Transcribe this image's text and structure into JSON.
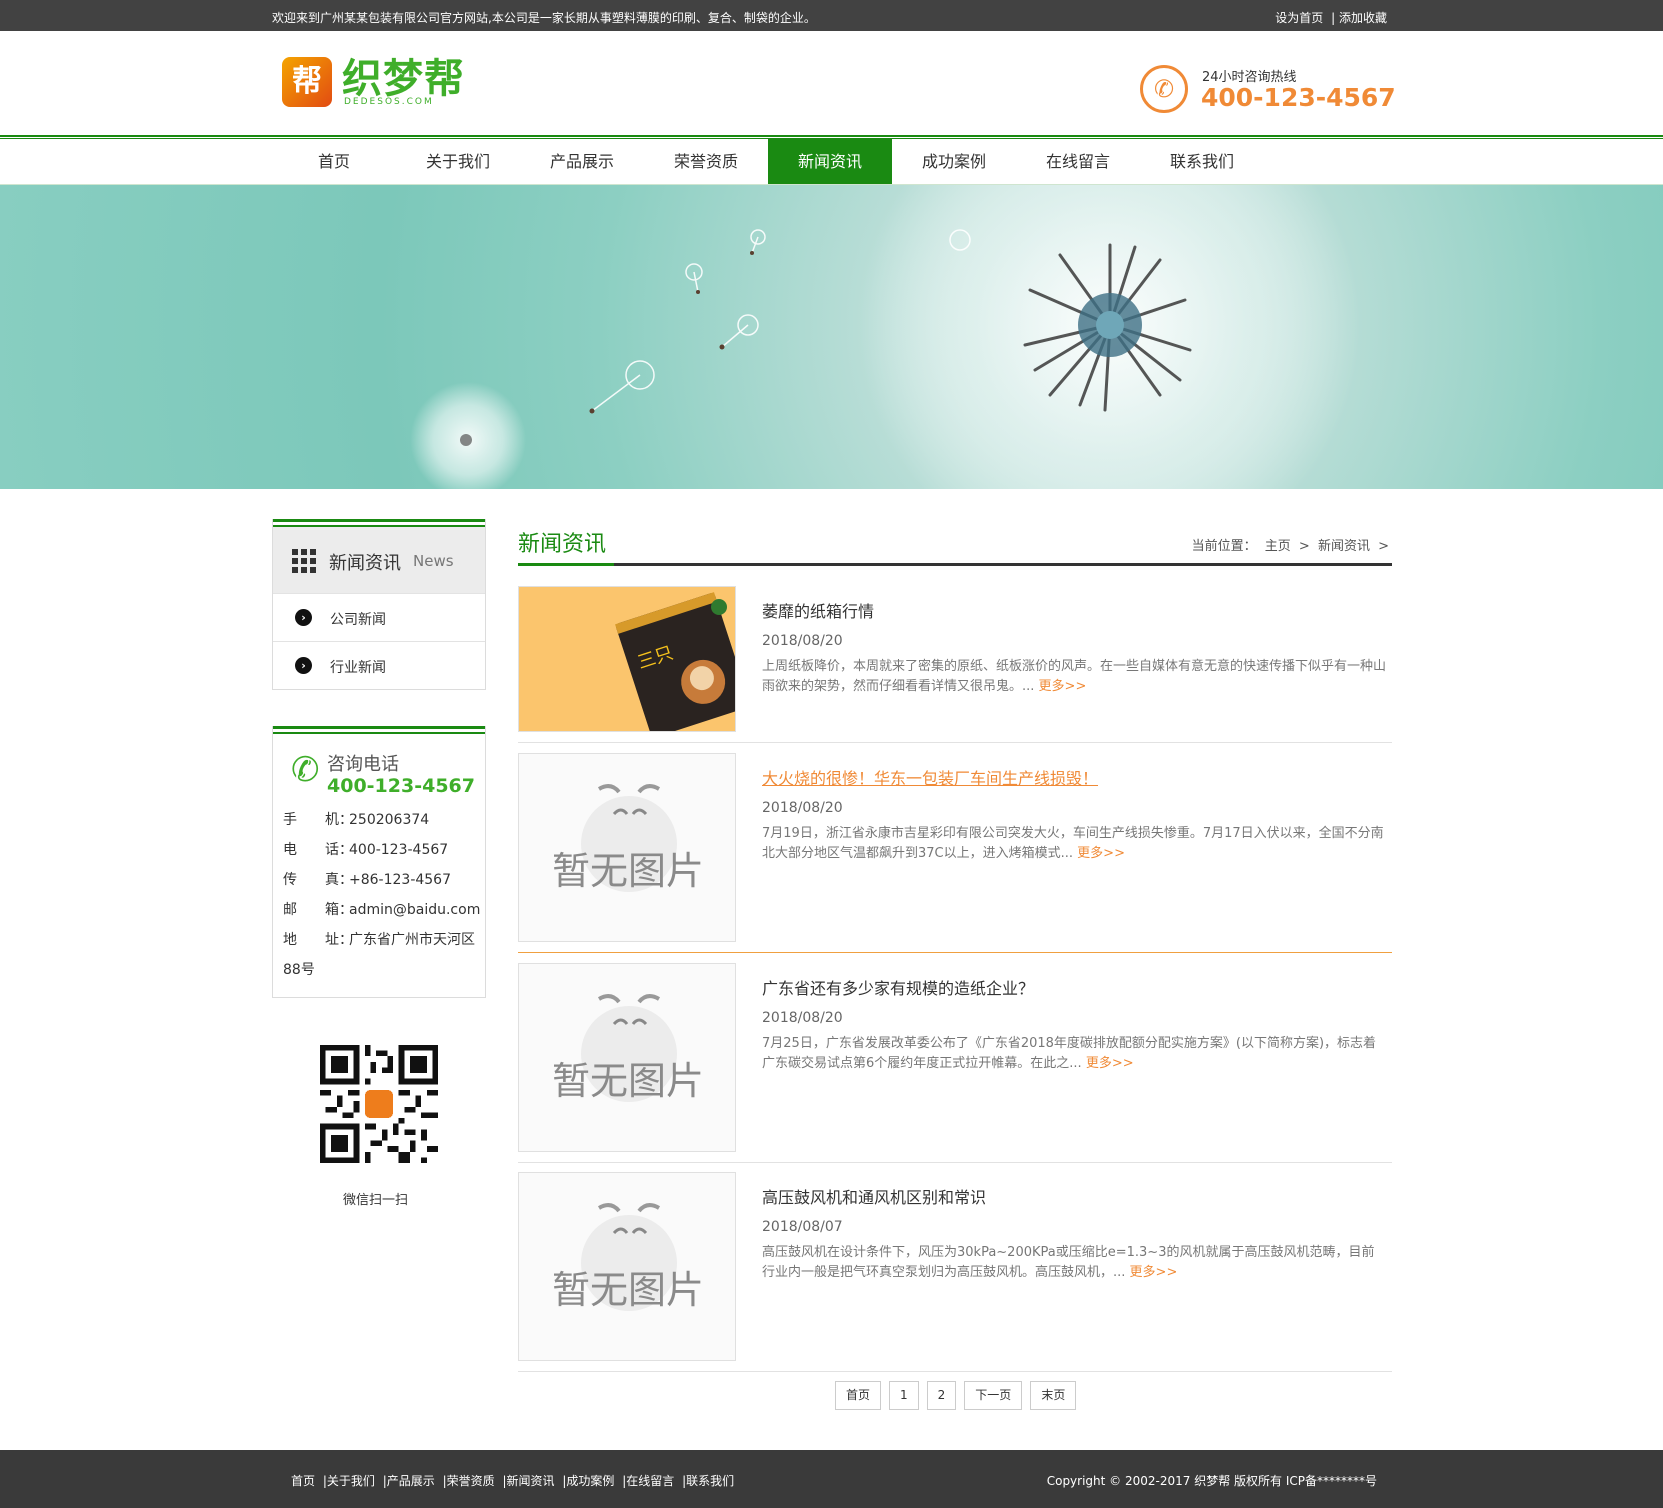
{
  "topbar": {
    "welcome": "欢迎来到广州某某包装有限公司官方网站,本公司是一家长期从事塑料薄膜的印刷、复合、制袋的企业。",
    "set_home": "设为首页",
    "separator": "|",
    "add_favorite": "添加收藏"
  },
  "header": {
    "logo_mark": "帮",
    "logo_text": "织梦帮",
    "logo_sub": "DEDESOS.COM",
    "hotline_label": "24小时咨询热线",
    "hotline_number": "400-123-4567",
    "phone_icon": "phone-icon"
  },
  "nav": {
    "items": [
      "首页",
      "关于我们",
      "产品展示",
      "荣誉资质",
      "新闻资讯",
      "成功案例",
      "在线留言",
      "联系我们"
    ],
    "active_index": 4,
    "accent": "#1a8a12"
  },
  "sidebar": {
    "category_title": "新闻资讯",
    "category_en": "News",
    "items": [
      "公司新闻",
      "行业新闻"
    ],
    "contact_title": "咨询电话",
    "contact_number": "400-123-4567",
    "contact_lines": [
      {
        "label": "手　　机：",
        "value": "250206374"
      },
      {
        "label": "电　　话：",
        "value": "400-123-4567"
      },
      {
        "label": "传　　真：",
        "value": "+86-123-4567"
      },
      {
        "label": "邮　　箱：",
        "value": "admin@baidu.com"
      },
      {
        "label": "地　　址：",
        "value": "广东省广州市天河区"
      }
    ],
    "address_cont": "88号",
    "qr_caption": "微信扫一扫"
  },
  "main": {
    "title": "新闻资讯",
    "breadcrumb_label": "当前位置：",
    "breadcrumb": [
      "主页",
      ">",
      "新闻资讯",
      ">"
    ],
    "placeholder_text": "暂无图片",
    "news": [
      {
        "title": "萎靡的纸箱行情",
        "date": "2018/08/20",
        "desc": "上周纸板降价，本周就来了密集的原纸、纸板涨价的风声。在一些自媒体有意无意的快速传播下似乎有一种山雨欲来的架势，然而仔细看看详情又很吊鬼。...",
        "more": "更多>>"
      },
      {
        "title": "大火烧的很惨！华东一包装厂车间生产线损毁！",
        "date": "2018/08/20",
        "desc": "7月19日，浙江省永康市吉星彩印有限公司突发大火，车间生产线损失惨重。7月17日入伏以来，全国不分南北大部分地区气温都飙升到37C以上，进入烤箱模式...",
        "more": "更多>>"
      },
      {
        "title": "广东省还有多少家有规模的造纸企业？",
        "date": "2018/08/20",
        "desc": "7月25日，广东省发展改革委公布了《广东省2018年度碳排放配额分配实施方案》(以下简称方案)，标志着广东碳交易试点第6个履约年度正式拉开帷幕。在此之...",
        "more": "更多>>"
      },
      {
        "title": "高压鼓风机和通风机区别和常识",
        "date": "2018/08/07",
        "desc": "高压鼓风机在设计条件下，风压为30kPa~200KPa或压缩比e=1.3~3的风机就属于高压鼓风机范畴，目前行业内一般是把气环真空泵划归为高压鼓风机。高压鼓风机，...",
        "more": "更多>>"
      }
    ],
    "pager": [
      "首页",
      "1",
      "2",
      "下一页",
      "末页"
    ]
  },
  "footer": {
    "links": [
      "首页",
      "|关于我们",
      "|产品展示",
      "|荣誉资质",
      "|新闻资讯",
      "|成功案例",
      "|在线留言",
      "|联系我们"
    ],
    "copyright": "Copyright © 2002-2017 织梦帮 版权所有 ICP备********号"
  }
}
